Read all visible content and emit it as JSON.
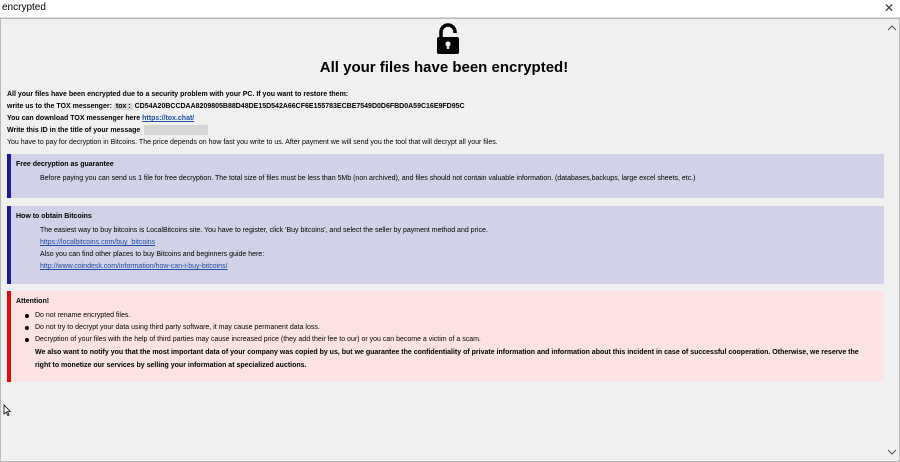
{
  "window": {
    "title": "encrypted",
    "close_glyph": "✕"
  },
  "header": {
    "lock_icon": "lock-icon",
    "headline": "All your files have been encrypted!"
  },
  "intro": {
    "line1": "All your files have been encrypted due to a security problem with your PC. If you want to restore them:",
    "line2_prefix": "write us to the TOX messenger:",
    "tox_label": "tox :",
    "tox_id": "CD54A20BCCDAA8209805B88D48DE15D542A66CF6E155783ECBE7549D0D6FBD0A59C16E9FD95C",
    "line3_prefix": "You can download TOX messenger here",
    "tox_link": "https://tox.chat/",
    "line4": "Write this ID in the title of your message",
    "line5": "You have to pay for decryption in Bitcoins. The price depends on how fast you write to us. After payment we will send you the tool that will decrypt all your files."
  },
  "guarantee": {
    "title": "Free decryption as guarantee",
    "text": "Before paying you can send us 1 file for free decryption. The total size of files must be less than 5Mb (non archived), and files should not contain valuable information. (databases,backups, large excel sheets, etc.)"
  },
  "bitcoins": {
    "title": "How to obtain Bitcoins",
    "text1": "The easiest way to buy bitcoins is LocalBitcoins site. You have to register, click 'Buy bitcoins', and select the seller by payment method and price.",
    "link1": "https://localbitcoins.com/buy_bitcoins",
    "text2": "Also you can find other places to buy Bitcoins and beginners guide here:",
    "link2": "http://www.coindesk.com/information/how-can-i-buy-bitcoins/"
  },
  "attention": {
    "title": "Attention!",
    "items": [
      "Do not rename encrypted files.",
      "Do not try to decrypt your data using third party software, it may cause permanent data loss.",
      "Decryption of your files with the help of third parties may cause increased price (they add their fee to our) or you can become a victim of a scam."
    ],
    "notice": "We also want to notify you that the most important data of your company was copied by us, but we guarantee the confidentiality of private information and information about this incident in case of successful cooperation. Otherwise, we reserve the right to monetize our services by selling your information at specialized auctions."
  },
  "colors": {
    "blue_bar": "#1a1a9a",
    "red_bar": "#e10b0b",
    "blue_panel": "#d1d1e7",
    "red_panel": "#fce3e3"
  }
}
